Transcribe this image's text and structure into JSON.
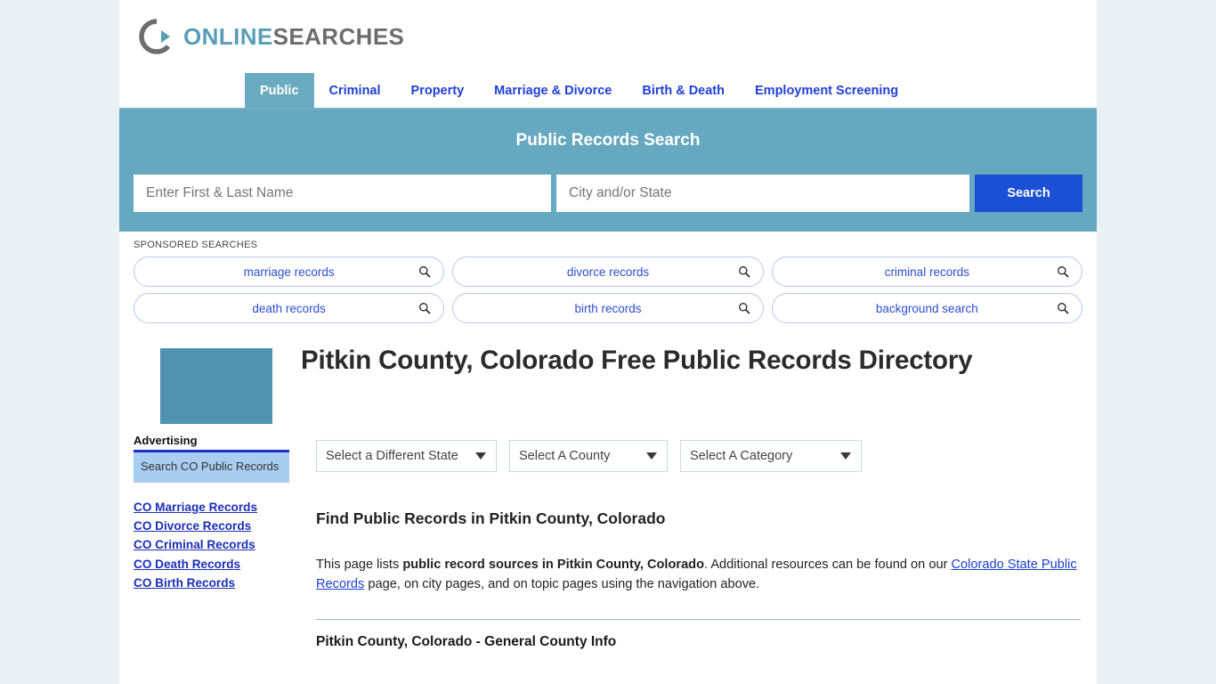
{
  "brand": {
    "logo_icon": "circular-arrow-logo-icon",
    "name_part1": "ONLINE",
    "name_part2": "SEARCHES",
    "accent_color": "#5a9db8",
    "secondary_color": "#6d6d6d"
  },
  "nav": {
    "items": [
      {
        "label": "Public",
        "active": true
      },
      {
        "label": "Criminal",
        "active": false
      },
      {
        "label": "Property",
        "active": false
      },
      {
        "label": "Marriage & Divorce",
        "active": false
      },
      {
        "label": "Birth & Death",
        "active": false
      },
      {
        "label": "Employment Screening",
        "active": false
      }
    ]
  },
  "search": {
    "title": "Public Records Search",
    "name_value": "",
    "name_placeholder": "Enter First & Last Name",
    "city_value": "",
    "city_placeholder": "City and/or State",
    "button_label": "Search",
    "band_color": "#65a8bf",
    "button_color": "#1a4fd6"
  },
  "sponsored": {
    "label": "SPONSORED SEARCHES",
    "chips": [
      {
        "label": "marriage records",
        "icon": "search-icon"
      },
      {
        "label": "divorce records",
        "icon": "search-icon"
      },
      {
        "label": "criminal records",
        "icon": "search-icon"
      },
      {
        "label": "death records",
        "icon": "search-icon"
      },
      {
        "label": "birth records",
        "icon": "search-icon"
      },
      {
        "label": "background search",
        "icon": "search-icon"
      }
    ]
  },
  "hero": {
    "thumbnail_color": "#4f93b0",
    "title": "Pitkin County, Colorado Free Public Records Directory"
  },
  "selectors": [
    {
      "label": "Select a Different State",
      "icon": "chevron-down-icon"
    },
    {
      "label": "Select A County",
      "icon": "chevron-down-icon"
    },
    {
      "label": "Select A Category",
      "icon": "chevron-down-icon"
    }
  ],
  "main": {
    "section_heading": "Find Public Records in Pitkin County, Colorado",
    "paragraph": {
      "pre": "This page lists ",
      "bold1": "public record sources in Pitkin County, Colorado",
      "mid": ". Additional resources can be found on our ",
      "link": "Colorado State Public Records",
      "post": " page, on city pages, and on topic pages using the navigation above."
    },
    "subsection_heading": "Pitkin County, Colorado - General County Info"
  },
  "sidebar": {
    "advertising_label": "Advertising",
    "ad_box_text": "Search CO Public Records",
    "ad_box_color": "#a9cdf0",
    "links": [
      "CO Marriage Records",
      "CO Divorce Records",
      "CO Criminal Records",
      "CO Death Records",
      "CO Birth Records"
    ]
  }
}
